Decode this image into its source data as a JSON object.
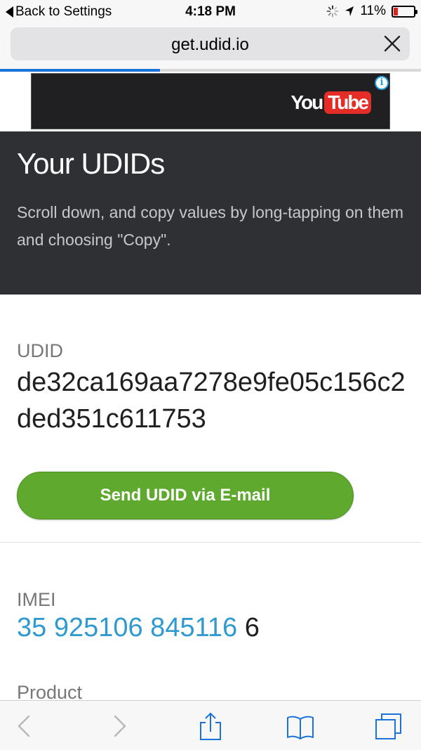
{
  "status_bar": {
    "back_label": "Back to Settings",
    "time": "4:18 PM",
    "battery": "11%",
    "battery_level": 0.11
  },
  "browser": {
    "url": "get.udid.io",
    "load_progress": 0.38
  },
  "ad": {
    "brand_you": "You",
    "brand_tube": "Tube",
    "info_glyph": "i"
  },
  "hero": {
    "title": "Your UDIDs",
    "subtitle": "Scroll down, and copy values by long-tapping on them and choosing \"Copy\"."
  },
  "udid": {
    "label": "UDID",
    "value": "de32ca169aa7278e9fe05c156c2ded351c611753",
    "send_button": "Send UDID via E-mail"
  },
  "imei": {
    "label": "IMEI",
    "value_link": "35 925106 845116",
    "value_suffix": " 6"
  },
  "product": {
    "label": "Product"
  },
  "toolbar": {
    "icons": [
      "back-icon",
      "forward-icon",
      "share-icon",
      "bookmarks-icon",
      "tabs-icon"
    ]
  },
  "colors": {
    "accent_blue": "#1a73d9",
    "button_green": "#5ea92e",
    "link_blue": "#2f9ad0",
    "hero_bg": "#2f3034",
    "youtube_red": "#e52d27"
  }
}
